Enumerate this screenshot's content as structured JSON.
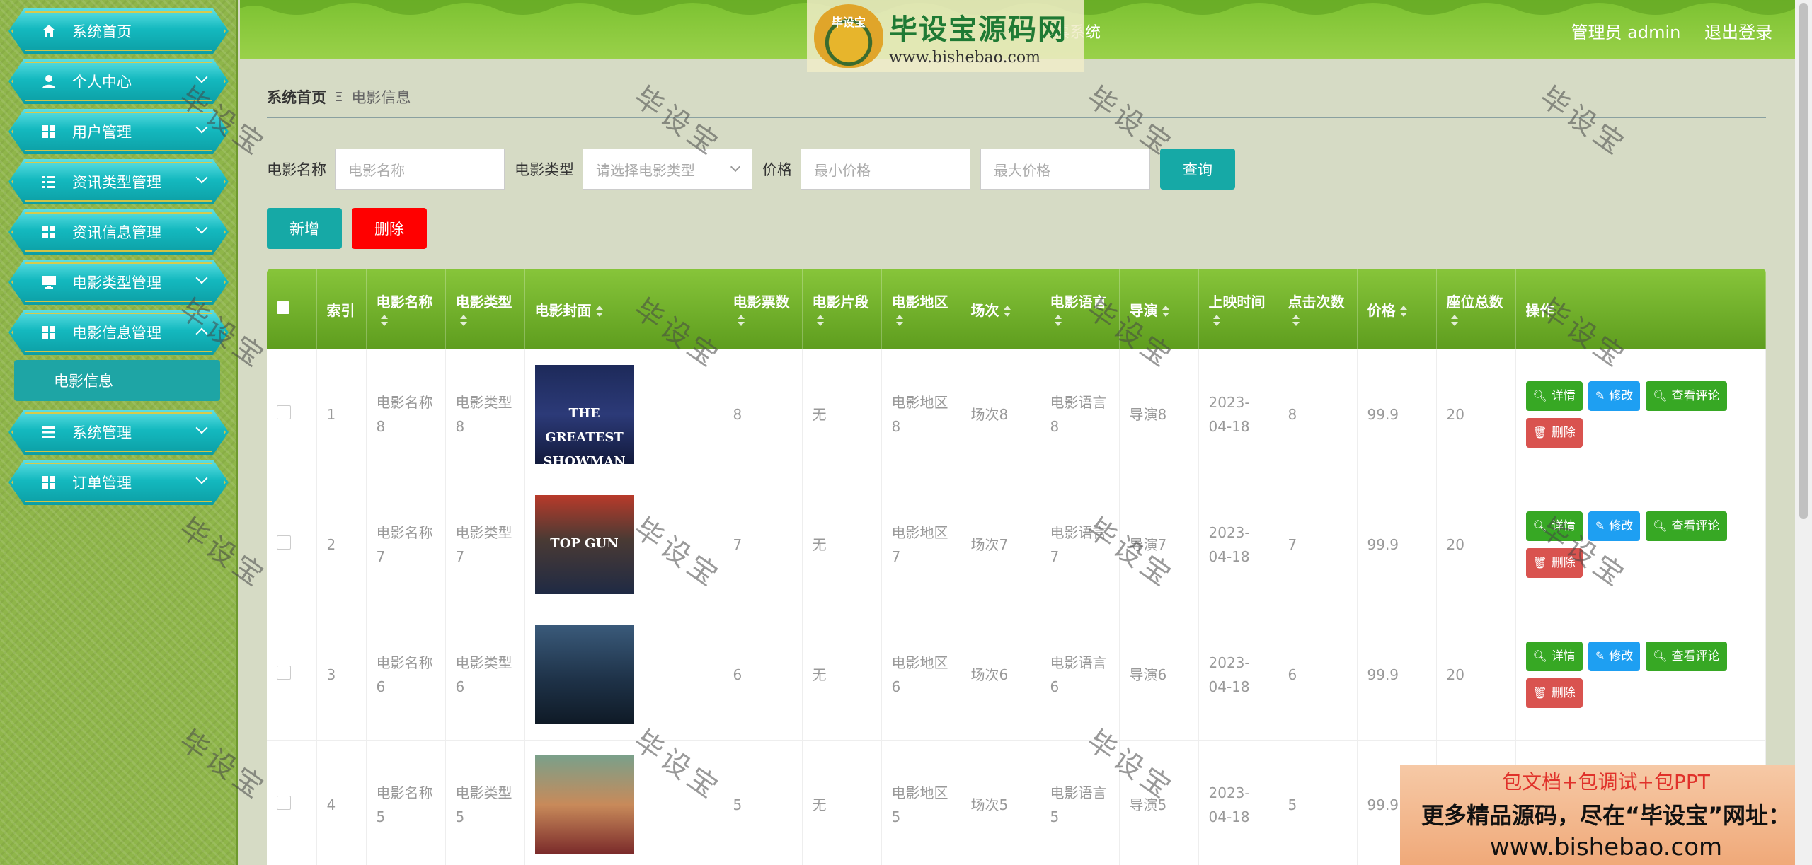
{
  "sidebar": {
    "items": [
      {
        "label": "系统首页",
        "icon": "home-icon",
        "arrow": false
      },
      {
        "label": "个人中心",
        "icon": "user-icon",
        "arrow": true
      },
      {
        "label": "用户管理",
        "icon": "grid-icon",
        "arrow": true
      },
      {
        "label": "资讯类型管理",
        "icon": "list-icon",
        "arrow": true
      },
      {
        "label": "资讯信息管理",
        "icon": "grid-icon",
        "arrow": true
      },
      {
        "label": "电影类型管理",
        "icon": "monitor-icon",
        "arrow": true
      },
      {
        "label": "电影信息管理",
        "icon": "grid-icon",
        "arrow": "up"
      },
      {
        "label": "系统管理",
        "icon": "menu-icon",
        "arrow": true
      },
      {
        "label": "订单管理",
        "icon": "grid-icon",
        "arrow": true
      }
    ],
    "submenu_label": "电影信息"
  },
  "header": {
    "title_fragment": "票系统",
    "user_label": "管理员 admin",
    "logout_label": "退出登录",
    "logo_badge": "毕设宝",
    "logo_cn": "毕设宝源码网",
    "logo_url": "www.bishebao.com"
  },
  "breadcrumb": {
    "home": "系统首页",
    "separator": "Ξ",
    "current": "电影信息"
  },
  "search": {
    "name_label": "电影名称",
    "name_placeholder": "电影名称",
    "type_label": "电影类型",
    "type_placeholder": "请选择电影类型",
    "price_label": "价格",
    "min_placeholder": "最小价格",
    "max_placeholder": "最大价格",
    "query_label": "查询"
  },
  "actions": {
    "add_label": "新增",
    "delete_label": "删除"
  },
  "table": {
    "columns": [
      "索引",
      "电影名称",
      "电影类型",
      "电影封面",
      "电影票数",
      "电影片段",
      "电影地区",
      "场次",
      "电影语言",
      "导演",
      "上映时间",
      "点击次数",
      "价格",
      "座位总数",
      "操作"
    ],
    "buttons": {
      "detail": "详情",
      "edit": "修改",
      "review": "查看评论",
      "remove": "删除"
    },
    "rows": [
      {
        "index": "1",
        "name": "电影名称8",
        "type": "电影类型8",
        "poster": "THE GREATEST SHOWMAN",
        "tickets": "8",
        "clip": "无",
        "region": "电影地区8",
        "session": "场次8",
        "lang": "电影语言8",
        "director": "导演8",
        "date": "2023-04-18",
        "clicks": "8",
        "price": "99.9",
        "seats": "20"
      },
      {
        "index": "2",
        "name": "电影名称7",
        "type": "电影类型7",
        "poster": "TOP GUN",
        "tickets": "7",
        "clip": "无",
        "region": "电影地区7",
        "session": "场次7",
        "lang": "电影语言7",
        "director": "导演7",
        "date": "2023-04-18",
        "clicks": "7",
        "price": "99.9",
        "seats": "20"
      },
      {
        "index": "3",
        "name": "电影名称6",
        "type": "电影类型6",
        "poster": "",
        "tickets": "6",
        "clip": "无",
        "region": "电影地区6",
        "session": "场次6",
        "lang": "电影语言6",
        "director": "导演6",
        "date": "2023-04-18",
        "clicks": "6",
        "price": "99.9",
        "seats": "20"
      },
      {
        "index": "4",
        "name": "电影名称5",
        "type": "电影类型5",
        "poster": "",
        "tickets": "5",
        "clip": "无",
        "region": "电影地区5",
        "session": "场次5",
        "lang": "电影语言5",
        "director": "导演5",
        "date": "2023-04-18",
        "clicks": "5",
        "price": "99.9",
        "seats": ""
      }
    ]
  },
  "watermark": "毕设宝",
  "promo": {
    "line1": "包文档+包调试+包PPT",
    "line2": "更多精品源码，尽在“毕设宝”网址：",
    "line3": "www.bishebao.com"
  },
  "colors": {
    "accent": "#16a9a6",
    "danger": "#ff0000",
    "header_green": "#7cc231"
  }
}
